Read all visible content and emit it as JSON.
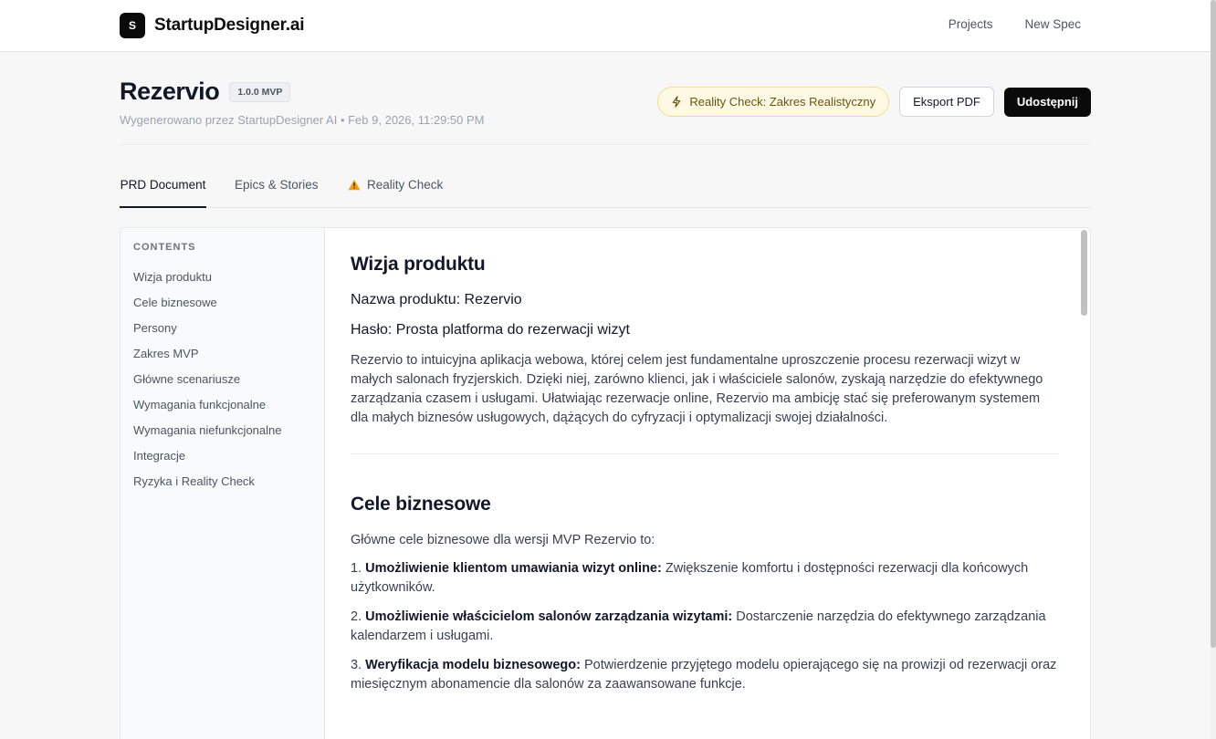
{
  "brand": {
    "logo_letter": "S",
    "name": "StartupDesigner.ai"
  },
  "top_nav": {
    "projects": "Projects",
    "new_spec": "New Spec"
  },
  "header": {
    "title": "Rezervio",
    "version": "1.0.0 MVP",
    "subtitle": "Wygenerowano przez StartupDesigner AI • Feb 9, 2026, 11:29:50 PM",
    "reality_check_label": "Reality Check: Zakres Realistyczny",
    "export_label": "Eksport PDF",
    "share_label": "Udostępnij"
  },
  "tabs": {
    "prd": "PRD Document",
    "epics": "Epics & Stories",
    "reality": "Reality Check",
    "active": "PRD Document"
  },
  "toc": {
    "heading": "CONTENTS",
    "items": [
      {
        "label": "Wizja produktu"
      },
      {
        "label": "Cele biznesowe"
      },
      {
        "label": "Persony"
      },
      {
        "label": "Zakres MVP"
      },
      {
        "label": "Główne scenariusze"
      },
      {
        "label": "Wymagania funkcjonalne"
      },
      {
        "label": "Wymagania niefunkcjonalne"
      },
      {
        "label": "Integracje"
      },
      {
        "label": "Ryzyka i Reality Check"
      }
    ]
  },
  "document": {
    "vision": {
      "heading": "Wizja produktu",
      "product_name": "Nazwa produktu: Rezervio",
      "slogan": "Hasło: Prosta platforma do rezerwacji wizyt",
      "body": "Rezervio to intuicyjna aplikacja webowa, której celem jest fundamentalne uproszczenie procesu rezerwacji wizyt w małych salonach fryzjerskich. Dzięki niej, zarówno klienci, jak i właściciele salonów, zyskają narzędzie do efektywnego zarządzania czasem i usługami. Ułatwiając rezerwacje online, Rezervio ma ambicję stać się preferowanym systemem dla małych biznesów usługowych, dążących do cyfryzacji i optymalizacji swojej działalności."
    },
    "goals": {
      "heading": "Cele biznesowe",
      "intro": "Główne cele biznesowe dla wersji MVP Rezervio to:",
      "items": [
        {
          "number": "1.",
          "title": "Umożliwienie klientom umawiania wizyt online:",
          "text": "Zwiększenie komfortu i dostępności rezerwacji dla końcowych użytkowników."
        },
        {
          "number": "2.",
          "title": "Umożliwienie właścicielom salonów zarządzania wizytami:",
          "text": "Dostarczenie narzędzia do efektywnego zarządzania kalendarzem i usługami."
        },
        {
          "number": "3.",
          "title": "Weryfikacja modelu biznesowego:",
          "text": "Potwierdzenie przyjętego modelu opierającego się na prowizji od rezerwacji oraz miesięcznym abonamencie dla salonów za zaawansowane funkcje."
        }
      ]
    }
  },
  "icons": {
    "reality_pill": "lightning-bolt-icon",
    "reality_tab": "warning-triangle-icon"
  },
  "colors": {
    "accent": "#0a0a0a",
    "pill_bg": "#fef9e3",
    "pill_text": "#6b5312",
    "warning": "#f59e0b"
  }
}
